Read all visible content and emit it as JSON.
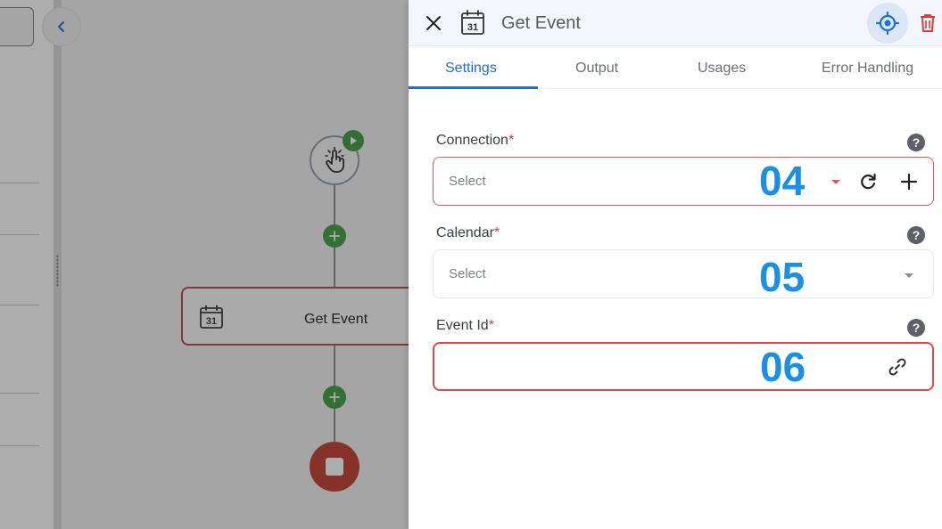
{
  "canvas": {
    "node_label": "Get Event",
    "calendar_icon_text": "31"
  },
  "header": {
    "title": "Get Event",
    "calendar_icon_text": "31"
  },
  "tabs": [
    {
      "label": "Settings",
      "active": true
    },
    {
      "label": "Output",
      "active": false
    },
    {
      "label": "Usages",
      "active": false
    },
    {
      "label": "Error Handling",
      "active": false
    }
  ],
  "fields": {
    "connection": {
      "label": "Connection",
      "required": "*",
      "placeholder": "Select",
      "step": "04",
      "help": "?"
    },
    "calendar": {
      "label": "Calendar",
      "required": "*",
      "placeholder": "Select",
      "step": "05",
      "help": "?"
    },
    "event_id": {
      "label": "Event Id",
      "required": "*",
      "value": "",
      "step": "06",
      "help": "?"
    }
  },
  "colors": {
    "accent": "#1e6fd0",
    "required": "#e53935",
    "step_number": "#1a8fe6",
    "delete": "#e53935",
    "error_border": "#e04848"
  },
  "icons": {
    "close": "close-icon",
    "calendar": "calendar-icon",
    "locate": "locate-icon",
    "delete": "trash-icon",
    "refresh": "refresh-icon",
    "add": "plus-icon",
    "link": "link-icon",
    "help": "help-icon"
  }
}
